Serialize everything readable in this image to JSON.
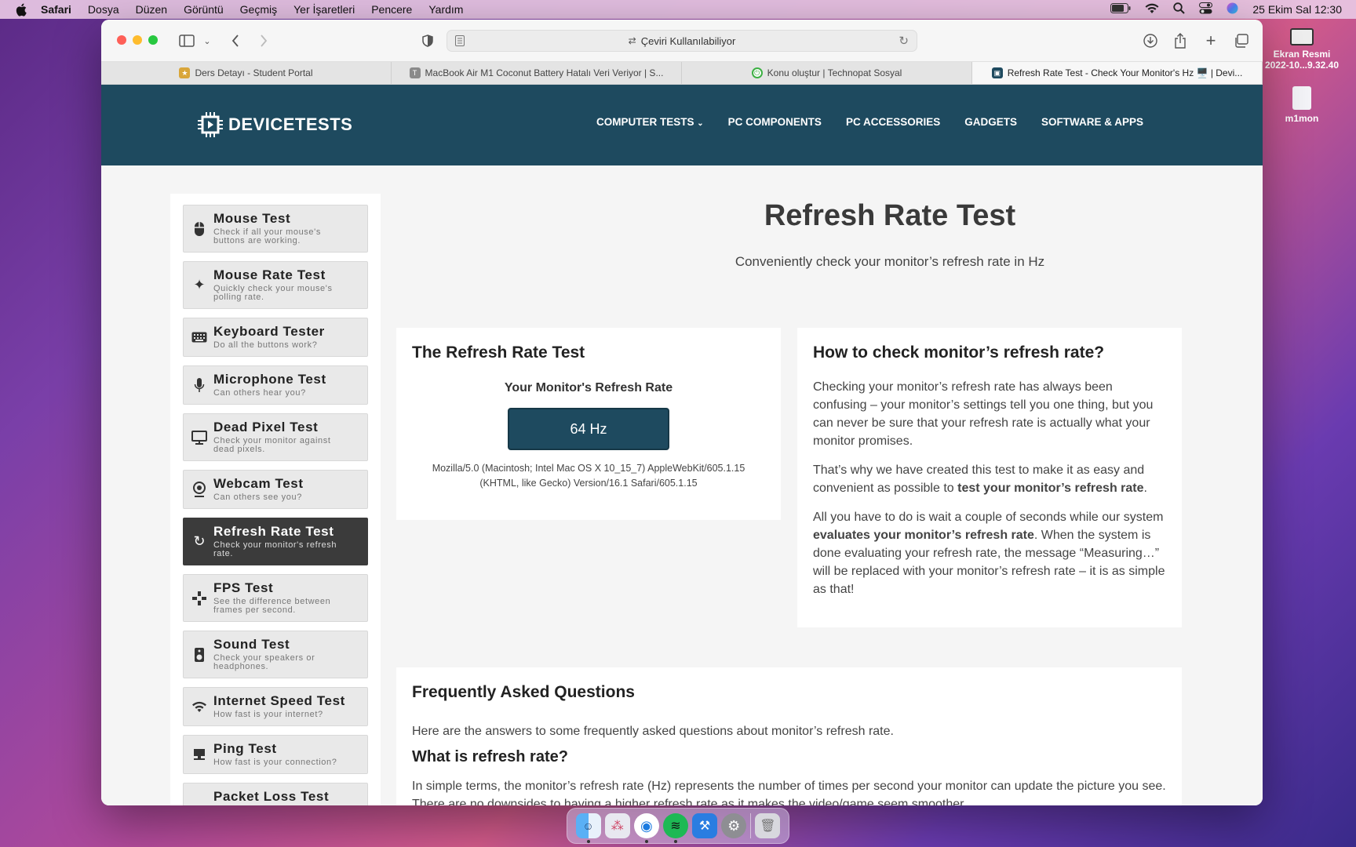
{
  "menubar": {
    "items": [
      "Safari",
      "Dosya",
      "Düzen",
      "Görüntü",
      "Geçmiş",
      "Yer İşaretleri",
      "Pencere",
      "Yardım"
    ],
    "clock": "25 Ekim Sal  12:30"
  },
  "desktop": {
    "screenshot_label_1": "Ekran Resmi",
    "screenshot_label_2": "2022-10...9.32.40",
    "file_label": "m1mon"
  },
  "browser": {
    "url_text": "Çeviri Kullanılabiliyor",
    "tabs": [
      {
        "label": "Ders Detayı - Student Portal"
      },
      {
        "label": "MacBook Air M1 Coconut Battery Hatalı Veri Veriyor | S..."
      },
      {
        "label": "Konu oluştur | Technopat Sosyal"
      },
      {
        "label": "Refresh Rate Test - Check Your Monitor's Hz 🖥️ | Devi..."
      }
    ]
  },
  "site": {
    "logo": "DEVICETESTS",
    "nav": [
      "COMPUTER TESTS",
      "PC COMPONENTS",
      "PC ACCESSORIES",
      "GADGETS",
      "SOFTWARE & APPS"
    ],
    "sidebar": [
      {
        "title": "Mouse Test",
        "desc": "Check if all your mouse's buttons are working."
      },
      {
        "title": "Mouse Rate Test",
        "desc": "Quickly check your mouse's polling rate."
      },
      {
        "title": "Keyboard Tester",
        "desc": "Do all the buttons work?"
      },
      {
        "title": "Microphone Test",
        "desc": "Can others hear you?"
      },
      {
        "title": "Dead Pixel Test",
        "desc": "Check your monitor against dead pixels."
      },
      {
        "title": "Webcam Test",
        "desc": "Can others see you?"
      },
      {
        "title": "Refresh Rate Test",
        "desc": "Check your monitor's refresh rate."
      },
      {
        "title": "FPS Test",
        "desc": "See the difference between frames per second."
      },
      {
        "title": "Sound Test",
        "desc": "Check your speakers or headphones."
      },
      {
        "title": "Internet Speed Test",
        "desc": "How fast is your internet?"
      },
      {
        "title": "Ping Test",
        "desc": "How fast is your connection?"
      },
      {
        "title": "Packet Loss Test",
        "desc": ""
      }
    ],
    "title": "Refresh Rate Test",
    "subtitle": "Conveniently check your monitor’s refresh rate in Hz",
    "rr_card": {
      "heading": "The Refresh Rate Test",
      "label": "Your Monitor's Refresh Rate",
      "value": "64 Hz",
      "ua_line1": "Mozilla/5.0 (Macintosh; Intel Mac OS X 10_15_7) AppleWebKit/605.1.15",
      "ua_line2": "(KHTML, like Gecko) Version/16.1 Safari/605.1.15"
    },
    "how_card": {
      "heading": "How to check monitor’s refresh rate?",
      "p1": "Checking your monitor’s refresh rate has always been confusing – your monitor’s settings tell you one thing, but you can never be sure that your refresh rate is actually what your monitor promises.",
      "p2_a": "That’s why we have created this test to make it as easy and convenient as possible to ",
      "p2_b": "test your monitor’s refresh rate",
      "p2_c": ".",
      "p3_a": "All you have to do is wait a couple of seconds while our system ",
      "p3_b": "evaluates your monitor’s refresh rate",
      "p3_c": ". When the system is done evaluating your refresh rate, the message “Measuring…” will be replaced with your monitor’s refresh rate – it is as simple as that!"
    },
    "faq": {
      "heading": "Frequently Asked Questions",
      "intro": "Here are the answers to some frequently asked questions about monitor’s refresh rate.",
      "q1": "What is refresh rate?",
      "a1": "In simple terms, the monitor’s refresh rate (Hz) represents the number of times per second your monitor can update the picture you see. There are no downsides to having a higher refresh rate as it makes the video/game seem smoother."
    }
  },
  "colors": {
    "header": "#1e4a5f",
    "active_item": "#3b3b3b"
  }
}
